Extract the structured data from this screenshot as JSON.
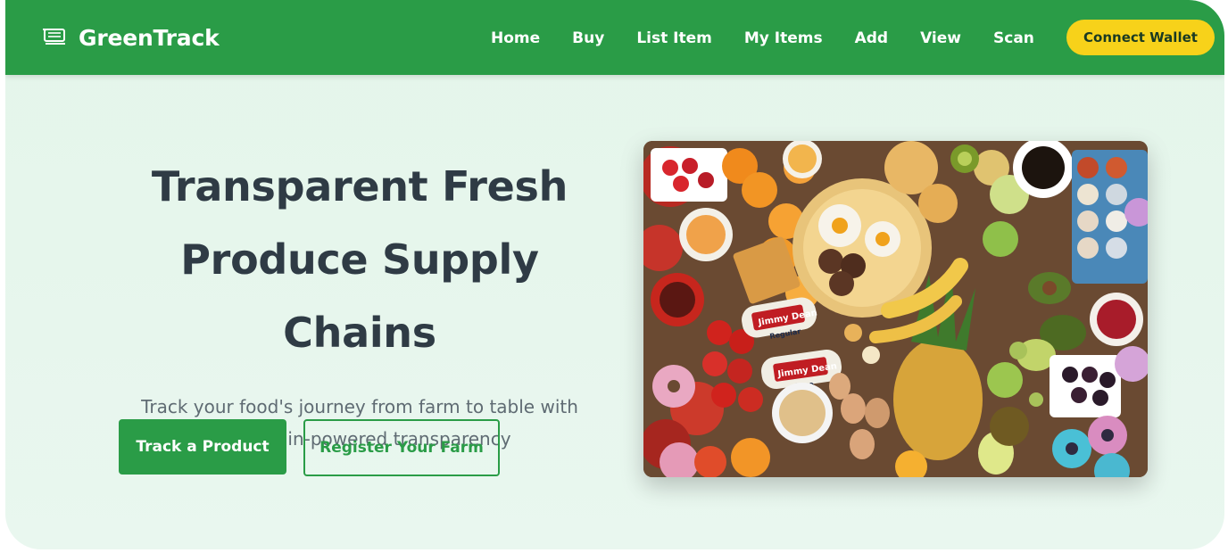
{
  "navbar": {
    "brand_name": "GreenTrack",
    "brand_icon": "shopping-cart-icon",
    "links": [
      "Home",
      "Buy",
      "List Item",
      "My Items",
      "Add",
      "View",
      "Scan"
    ],
    "connect_label": "Connect Wallet"
  },
  "hero": {
    "title_line1": "Transparent Fresh",
    "title_line2": "Produce Supply Chains",
    "subtitle_line1": "Track your food's journey from farm to table with",
    "subtitle_line2": "blockchain-powered transparency",
    "primary_button": "Track a Product",
    "secondary_button": "Register Your Farm",
    "image_labels": [
      "Jimmy Dean",
      "Regular",
      "Jimmy Dean",
      "Sage"
    ]
  },
  "colors": {
    "brand_green": "#2a9c47",
    "accent_yellow": "#f7d21a",
    "hero_background": "#e6f6ec",
    "title_text": "#2f3b45"
  }
}
